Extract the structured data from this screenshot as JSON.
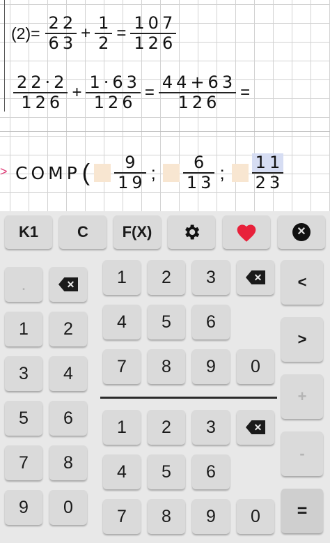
{
  "notebook": {
    "line1": {
      "prefix": "(2)=",
      "f1": {
        "num": "22",
        "den": "63"
      },
      "op1": "+",
      "f2": {
        "num": "1",
        "den": "2"
      },
      "op2": "=",
      "f3": {
        "num": "107",
        "den": "126"
      }
    },
    "line2": {
      "f1": {
        "num": "22·2",
        "den": "126"
      },
      "op1": "+",
      "f2": {
        "num": "1·63",
        "den": "126"
      },
      "op2": "=",
      "f3": {
        "num": "44+63",
        "den": "126"
      },
      "op3": "="
    },
    "line3": {
      "arrow": ">",
      "func": "COMP",
      "paren": "(",
      "f1": {
        "num": "9",
        "den": "19"
      },
      "sep1": ";",
      "f2": {
        "num": "6",
        "den": "13"
      },
      "sep2": ";",
      "f3": {
        "num": "11",
        "den": "23"
      }
    }
  },
  "keyboard": {
    "top_row": {
      "k1": "K1",
      "c": "C",
      "fx": "F(X)",
      "settings_icon": "gear-icon",
      "favorite_icon": "heart-icon",
      "close_icon": "close-circle-icon"
    },
    "left_pad": {
      "dot": ".",
      "backspace_icon": "backspace-icon",
      "keys": [
        "1",
        "2",
        "3",
        "4",
        "5",
        "6",
        "7",
        "8",
        "9",
        "0"
      ]
    },
    "upper_pad": {
      "keys": [
        "1",
        "2",
        "3",
        "4",
        "5",
        "6",
        "7",
        "8",
        "9",
        "0"
      ],
      "backspace_icon": "backspace-icon"
    },
    "lower_pad": {
      "keys": [
        "1",
        "2",
        "3",
        "4",
        "5",
        "6",
        "7",
        "8",
        "9",
        "0"
      ],
      "backspace_icon": "backspace-icon"
    },
    "right_col": {
      "left": "<",
      "right": ">",
      "plus": "+",
      "minus": "-",
      "equals": "="
    }
  },
  "colors": {
    "paper": "#ffffff",
    "grid": "#d2d2d2",
    "keyboard_bg": "#e8e8e8",
    "key_bg": "#dadada",
    "heart": "#e8213b",
    "arrow": "#e0407a",
    "slot": "#f8e6d1",
    "highlight": "#d6ddf3"
  }
}
